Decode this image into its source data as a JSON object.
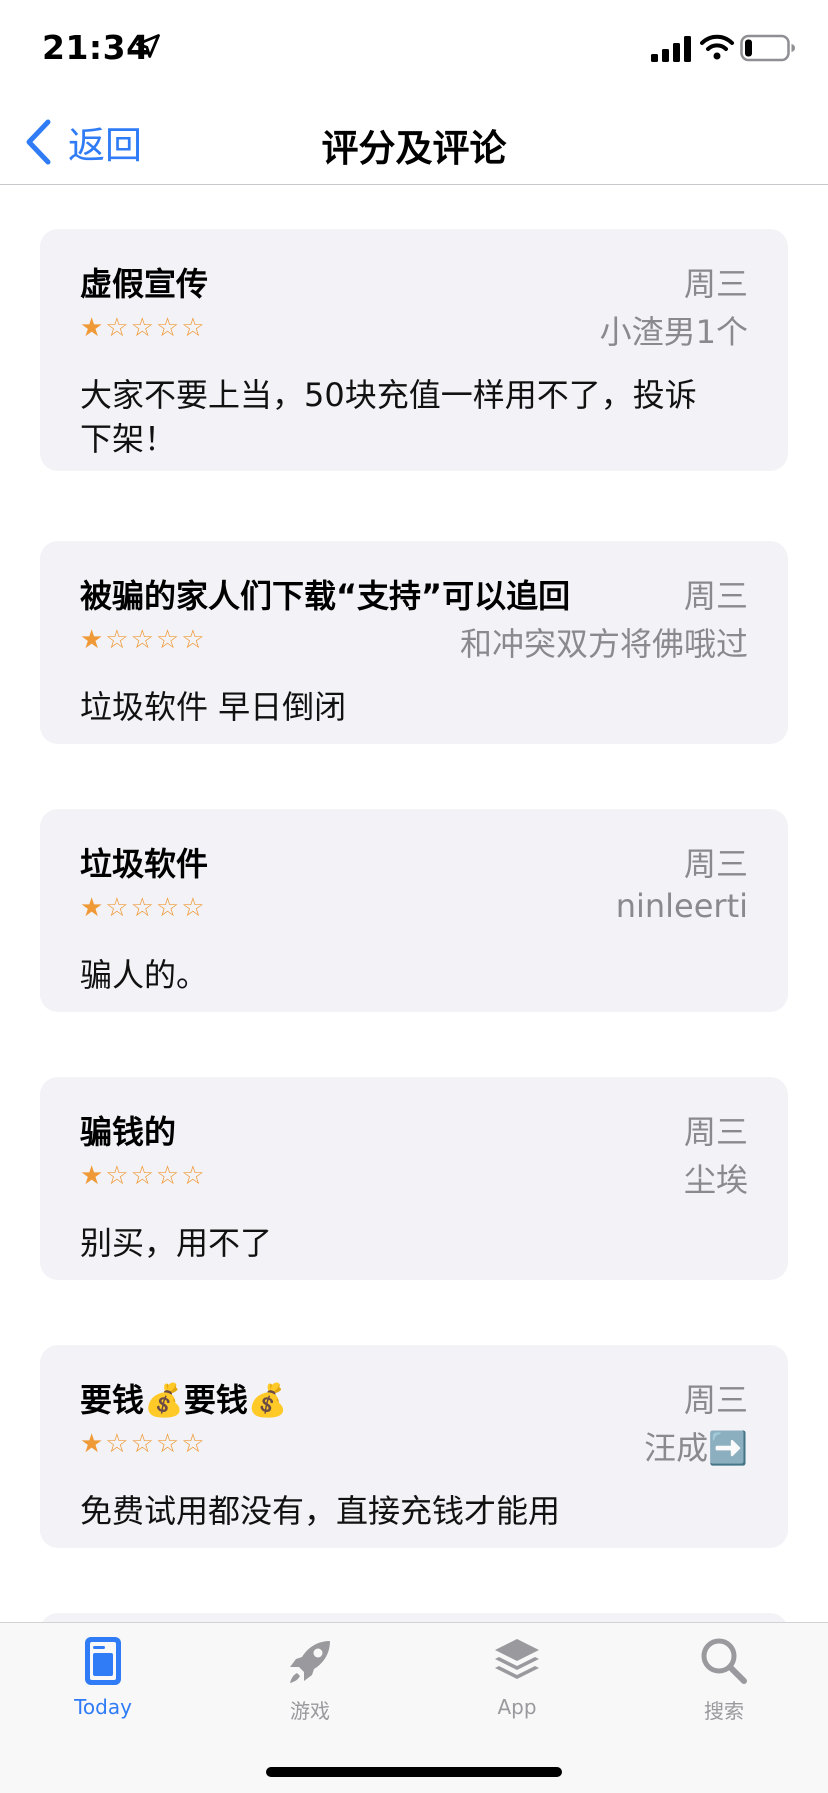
{
  "status_bar": {
    "time": "21:34"
  },
  "nav": {
    "back_label": "返回",
    "title": "评分及评论"
  },
  "reviews": [
    {
      "title": "虚假宣传",
      "date": "周三",
      "author": "小渣男1个",
      "rating": 1,
      "stars": "★☆☆☆☆",
      "body": "大家不要上当，50块充值一样用不了，投诉下架！"
    },
    {
      "title": "被骗的家人们下载“支持”可以追回",
      "date": "周三",
      "author": "和冲突双方将佛哦过",
      "rating": 1,
      "stars": "★☆☆☆☆",
      "body": "垃圾软件 早日倒闭"
    },
    {
      "title": "垃圾软件",
      "date": "周三",
      "author": "ninleerti",
      "rating": 1,
      "stars": "★☆☆☆☆",
      "body": "骗人的。"
    },
    {
      "title": "骗钱的",
      "date": "周三",
      "author": "尘埃",
      "rating": 1,
      "stars": "★☆☆☆☆",
      "body": "别买，用不了"
    },
    {
      "title": "要钱💰要钱💰",
      "date": "周三",
      "author": "汪成➡️",
      "rating": 1,
      "stars": "★☆☆☆☆",
      "body": "免费试用都没有，直接充钱才能用"
    }
  ],
  "tabs": [
    {
      "label": "Today",
      "icon": "today-icon",
      "active": true
    },
    {
      "label": "游戏",
      "icon": "rocket-icon",
      "active": false
    },
    {
      "label": "App",
      "icon": "layers-icon",
      "active": false
    },
    {
      "label": "搜索",
      "icon": "search-icon",
      "active": false
    }
  ],
  "colors": {
    "accent": "#2f7cf6",
    "star": "#f09a37",
    "card": "#f2f2f7",
    "secondary_text": "#8a8a8e"
  }
}
